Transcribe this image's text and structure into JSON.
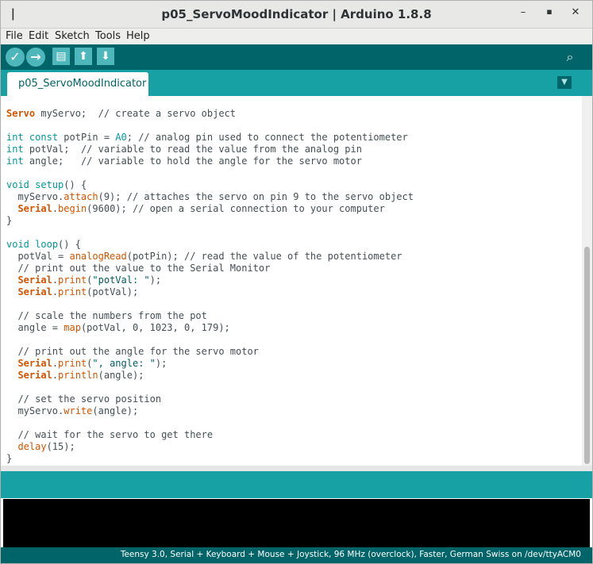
{
  "window": {
    "title": "p05_ServoMoodIndicator | Arduino 1.8.8",
    "menu_glyph": "ǀ",
    "minimize": "–",
    "maximize": "▪",
    "close": "✕"
  },
  "menu": [
    "File",
    "Edit",
    "Sketch",
    "Tools",
    "Help"
  ],
  "toolbar": {
    "verify": "✓",
    "upload": "→",
    "new": "▤",
    "open": "⬆",
    "save": "⬇",
    "serial_monitor": "⌕"
  },
  "tab": {
    "label": "p05_ServoMoodIndicator",
    "menu": "▼"
  },
  "code_lines": [
    "Servo myServo;  // create a servo object",
    "",
    "int const potPin = A0; // analog pin used to connect the potentiometer",
    "int potVal;  // variable to read the value from the analog pin",
    "int angle;   // variable to hold the angle for the servo motor",
    "",
    "void setup() {",
    "  myServo.attach(9); // attaches the servo on pin 9 to the servo object",
    "  Serial.begin(9600); // open a serial connection to your computer",
    "}",
    "",
    "void loop() {",
    "  potVal = analogRead(potPin); // read the value of the potentiometer",
    "  // print out the value to the Serial Monitor",
    "  Serial.print(\"potVal: \");",
    "  Serial.print(potVal);",
    "",
    "  // scale the numbers from the pot",
    "  angle = map(potVal, 0, 1023, 0, 179);",
    "",
    "  // print out the angle for the servo motor",
    "  Serial.print(\", angle: \");",
    "  Serial.println(angle);",
    "",
    "  // set the servo position",
    "  myServo.write(angle);",
    "",
    "  // wait for the servo to get there",
    "  delay(15);",
    "}"
  ],
  "footer": {
    "board_info": "Teensy 3.0, Serial + Keyboard + Mouse + Joystick, 96 MHz (overclock), Faster, German Swiss on /dev/ttyACM0"
  },
  "colors": {
    "toolbar_bg": "#006468",
    "tabbar_bg": "#17a1a5",
    "keyword": "#00979c",
    "function": "#d35400"
  }
}
